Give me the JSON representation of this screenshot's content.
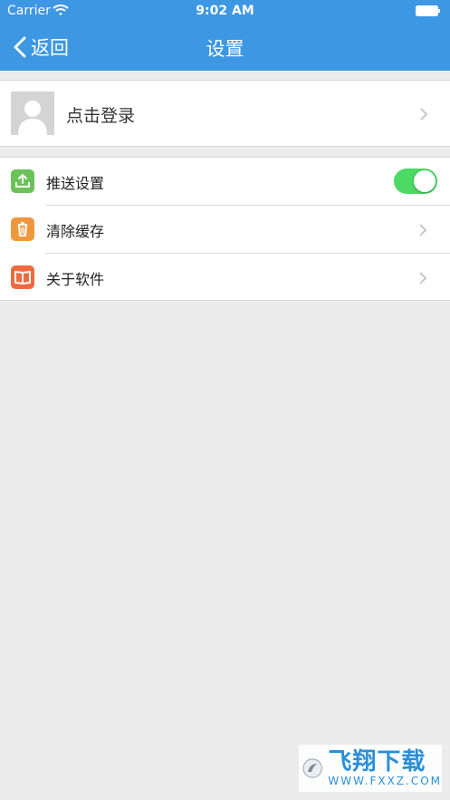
{
  "status_bar": {
    "carrier": "Carrier",
    "time": "9:02 AM"
  },
  "nav": {
    "back_label": "返回",
    "title": "设置"
  },
  "login": {
    "label": "点击登录"
  },
  "settings": {
    "items": [
      {
        "label": "推送设置",
        "icon": "push-upload-icon",
        "color": "#6ac259",
        "toggle": true
      },
      {
        "label": "清除缓存",
        "icon": "trash-icon",
        "color": "#f0973d"
      },
      {
        "label": "关于软件",
        "icon": "book-icon",
        "color": "#ef6a3e"
      }
    ]
  },
  "colors": {
    "nav_bg": "#3d97e3",
    "page_bg": "#ececec",
    "toggle_on": "#4cd964"
  },
  "watermark": {
    "main": "飞翔下载",
    "sub": "WWW.FXXZ.COM"
  }
}
